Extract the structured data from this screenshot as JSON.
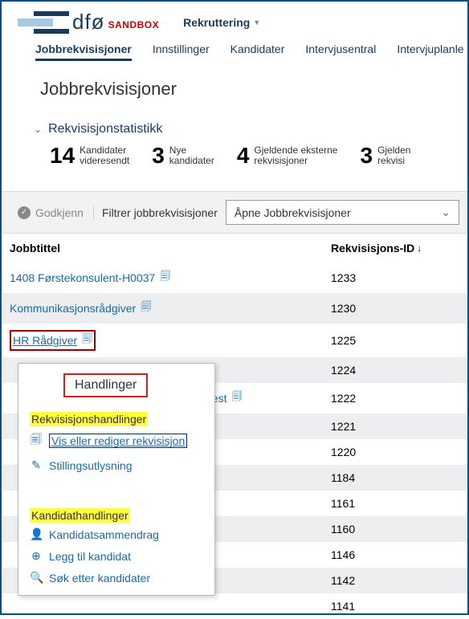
{
  "header": {
    "logo_text": "dfø",
    "sandbox": "SANDBOX",
    "module": "Rekruttering"
  },
  "nav": {
    "items": [
      "Jobbrekvisisjoner",
      "Innstillinger",
      "Kandidater",
      "Intervjusentral",
      "Intervjuplanle"
    ]
  },
  "page_title": "Jobbrekvisisjoner",
  "stats": {
    "title": "Rekvisisjonstatistikk",
    "items": [
      {
        "num": "14",
        "line1": "Kandidater",
        "line2": "videresendt"
      },
      {
        "num": "3",
        "line1": "Nye",
        "line2": "kandidater"
      },
      {
        "num": "4",
        "line1": "Gjeldende eksterne",
        "line2": "rekvisisjoner"
      },
      {
        "num": "3",
        "line1": "Gjelden",
        "line2": "rekvisi"
      }
    ]
  },
  "filters": {
    "approve": "Godkjenn",
    "filter_label": "Filtrer jobbrekvisisjoner",
    "dropdown_value": "Åpne Jobbrekvisisjoner"
  },
  "table": {
    "col_title": "Jobbtittel",
    "col_id": "Rekvisisjons-ID",
    "rows": [
      {
        "title": "1408 Førstekonsulent-H0037",
        "id": "1233"
      },
      {
        "title": "Kommunikasjonsrådgiver",
        "id": "1230"
      },
      {
        "title": "HR Rådgiver",
        "id": "1225",
        "highlight_redbox": true
      },
      {
        "title": "",
        "id": "1224"
      },
      {
        "title": "test",
        "id": "1222",
        "offset": true
      },
      {
        "title": "",
        "id": "1221"
      },
      {
        "title": "",
        "id": "1220"
      },
      {
        "title": "",
        "id": "1184"
      },
      {
        "title": "",
        "id": "1161"
      },
      {
        "title": "",
        "id": "1160"
      },
      {
        "title": "",
        "id": "1146"
      },
      {
        "title": "",
        "id": "1142"
      },
      {
        "title": "",
        "id": "1141"
      }
    ]
  },
  "popup": {
    "title": "Handlinger",
    "section1": "Rekvisisjonshandlinger",
    "item1": "Vis eller rediger rekvisisjon",
    "item2": "Stillingsutlysning",
    "section2": "Kandidathandlinger",
    "item3": "Kandidatsammendrag",
    "item4": "Legg til kandidat",
    "item5": "Søk etter kandidater"
  }
}
